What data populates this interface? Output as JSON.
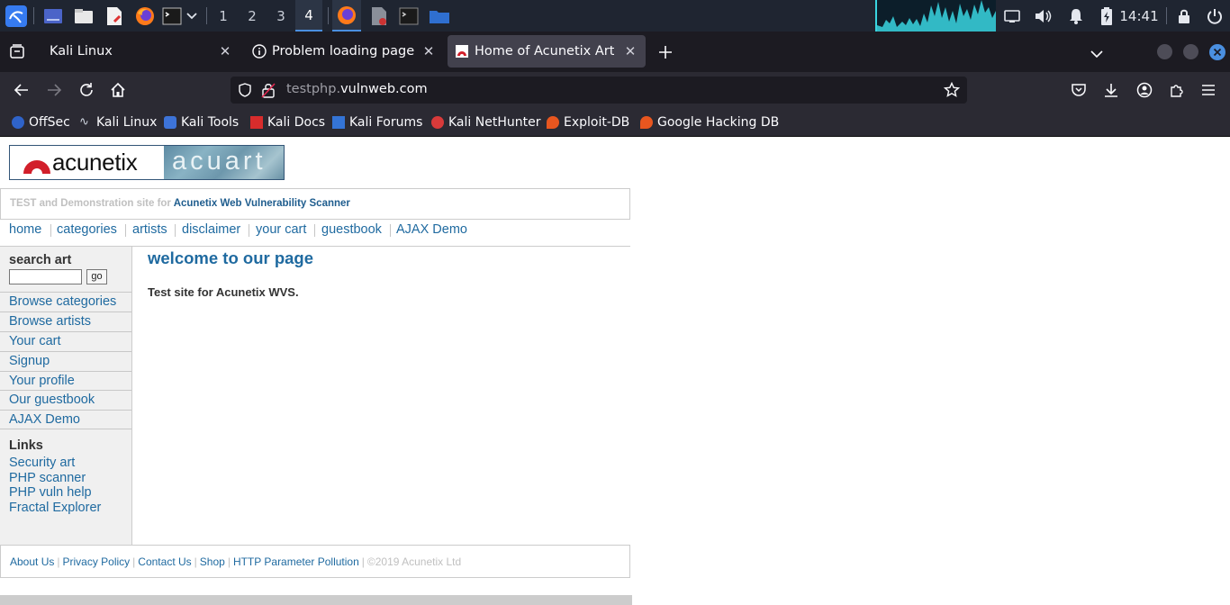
{
  "taskbar": {
    "workspaces": [
      "1",
      "2",
      "3",
      "4"
    ],
    "active_workspace": "4",
    "clock": "14:41"
  },
  "tabs": [
    {
      "label": "Kali Linux",
      "selected": false
    },
    {
      "label": "Problem loading page",
      "selected": false
    },
    {
      "label": "Home of Acunetix Art",
      "selected": true
    }
  ],
  "urlbar": {
    "host_prefix": "testphp.",
    "domain": "vulnweb.com"
  },
  "bookmarks": [
    {
      "label": "OffSec",
      "color": "#2f63c9"
    },
    {
      "label": "Kali Linux",
      "color": "#cfd6e0"
    },
    {
      "label": "Kali Tools",
      "color": "#3d73d8"
    },
    {
      "label": "Kali Docs",
      "color": "#d82c2c"
    },
    {
      "label": "Kali Forums",
      "color": "#3474d6"
    },
    {
      "label": "Kali NetHunter",
      "color": "#d83a3a"
    },
    {
      "label": "Exploit-DB",
      "color": "#e8561f"
    },
    {
      "label": "Google Hacking DB",
      "color": "#e8561f"
    }
  ],
  "site": {
    "logo_text": "acunetix",
    "logo_art_text": "acuart",
    "subheader_prefix": "TEST and Demonstration site for",
    "subheader_link": "Acunetix Web Vulnerability Scanner",
    "nav": [
      "home",
      "categories",
      "artists",
      "disclaimer",
      "your cart",
      "guestbook",
      "AJAX Demo"
    ],
    "search_title": "search art",
    "search_button": "go",
    "sidebar_items": [
      "Browse categories",
      "Browse artists",
      "Your cart",
      "Signup",
      "Your profile",
      "Our guestbook",
      "AJAX Demo"
    ],
    "links_title": "Links",
    "links": [
      "Security art",
      "PHP scanner",
      "PHP vuln help",
      "Fractal Explorer"
    ],
    "main_title": "welcome to our page",
    "main_text": "Test site for Acunetix WVS.",
    "footer_links": [
      "About Us",
      "Privacy Policy",
      "Contact Us",
      "Shop",
      "HTTP Parameter Pollution"
    ],
    "footer_copyright": "©2019 Acunetix Ltd",
    "link_color": "#1f6aa0"
  }
}
